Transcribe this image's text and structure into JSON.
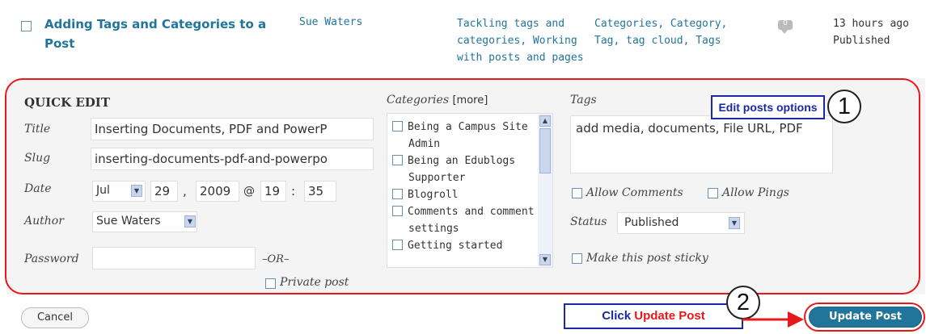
{
  "post": {
    "title": "Adding Tags and Categories to a Post",
    "author": "Sue Waters",
    "categories": "Tackling tags and categories, Working with posts and pages",
    "tags": "Categories, Category, Tag, tag cloud, Tags",
    "comments_count": "0",
    "date_ago": "13 hours ago",
    "status": "Published"
  },
  "quick_edit": {
    "heading": "QUICK EDIT",
    "labels": {
      "title": "Title",
      "slug": "Slug",
      "date": "Date",
      "author": "Author",
      "password": "Password",
      "or": "–OR–",
      "private_post": "Private post",
      "categories": "Categories",
      "more": "[more]",
      "tags": "Tags",
      "allow_comments": "Allow Comments",
      "allow_pings": "Allow Pings",
      "status": "Status",
      "sticky": "Make this post sticky"
    },
    "fields": {
      "title": "Inserting Documents, PDF and PowerP",
      "slug": "inserting-documents-pdf-and-powerpo",
      "month": "Jul",
      "day": "29",
      "year": "2009",
      "at": "@",
      "hour": "19",
      "colon": ":",
      "minute": "35",
      "comma": ",",
      "author": "Sue Waters",
      "password": "",
      "tags": "add media, documents, File URL, PDF",
      "status": "Published"
    },
    "category_items": [
      "Being a Campus Site Admin",
      "Being an Edublogs Supporter",
      "Blogroll",
      "Comments and comment settings",
      "Getting started"
    ],
    "buttons": {
      "cancel": "Cancel",
      "update": "Update Post"
    }
  },
  "annotations": {
    "callout1_text": "Edit posts options",
    "callout1_num": "1",
    "callout2_prefix": "Click ",
    "callout2_highlight": "Update Post",
    "callout2_num": "2"
  },
  "colors": {
    "link": "#21759b",
    "annotation_red": "#e8171a",
    "annotation_blue": "#1a2aa6",
    "update_button": "#21759b"
  }
}
